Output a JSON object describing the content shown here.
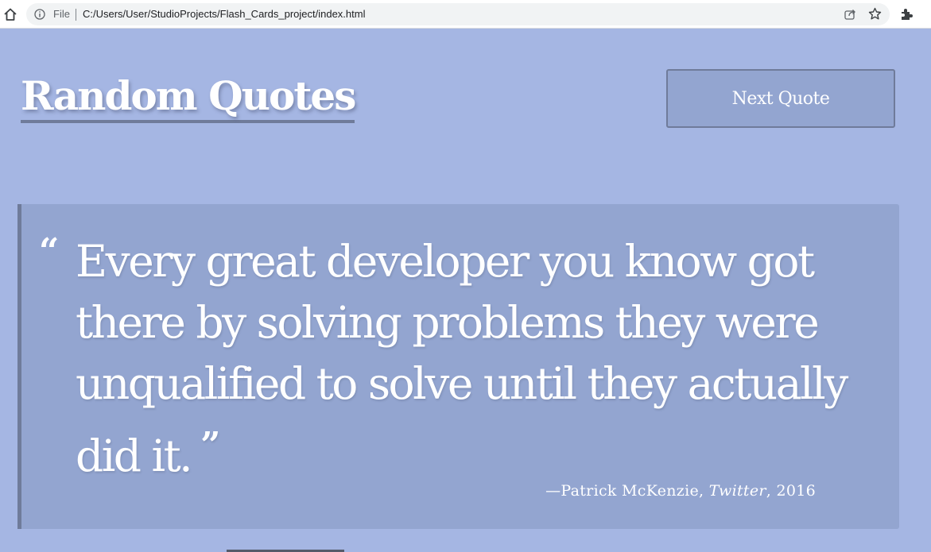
{
  "browser": {
    "file_label": "File",
    "url": "C:/Users/User/StudioProjects/Flash_Cards_project/index.html",
    "icons": [
      "home-icon",
      "info-icon",
      "share-icon",
      "star-icon",
      "extensions-icon"
    ]
  },
  "page": {
    "title": "Random Quotes",
    "next_button_label": "Next Quote",
    "quote": {
      "open_mark": "“",
      "text": "Every great developer you know got there by solving problems they were unqualified to solve until they actually did it.",
      "close_mark": "”",
      "citation_prefix": "—Patrick McKenzie, ",
      "citation_source": "Twitter",
      "citation_suffix": ", 2016"
    }
  },
  "colors": {
    "background": "#a5b6e3",
    "card": "#93a5d0",
    "accent_border": "#6f7b9a",
    "text": "#ffffff"
  }
}
